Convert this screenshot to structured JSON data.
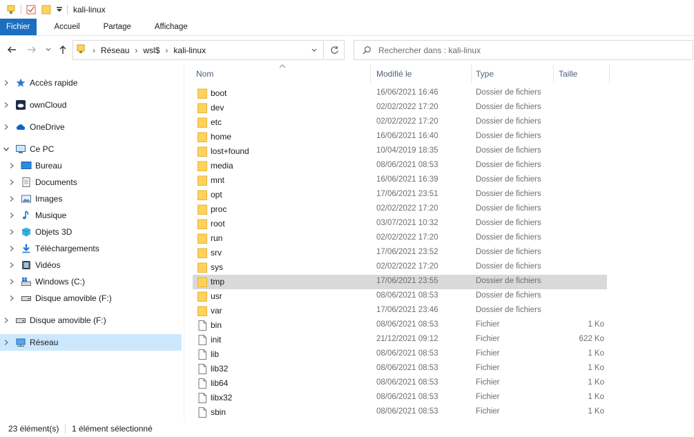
{
  "window": {
    "title": "kali-linux"
  },
  "ribbon": {
    "tabs": [
      "Fichier",
      "Accueil",
      "Partage",
      "Affichage"
    ]
  },
  "address": {
    "crumbs": [
      "Réseau",
      "wsl$",
      "kali-linux"
    ],
    "search_placeholder": "Rechercher dans : kali-linux"
  },
  "sidebar": {
    "items": [
      {
        "label": "Accès rapide",
        "icon": "star-icon",
        "level": 0,
        "expanded": false
      },
      {
        "label": "ownCloud",
        "icon": "owncloud-icon",
        "level": 0,
        "expanded": false
      },
      {
        "label": "OneDrive",
        "icon": "onedrive-icon",
        "level": 0,
        "expanded": false
      },
      {
        "label": "Ce PC",
        "icon": "pc-icon",
        "level": 0,
        "expanded": true
      },
      {
        "label": "Bureau",
        "icon": "desktop-icon",
        "level": 1,
        "expanded": false
      },
      {
        "label": "Documents",
        "icon": "documents-icon",
        "level": 1,
        "expanded": false
      },
      {
        "label": "Images",
        "icon": "images-icon",
        "level": 1,
        "expanded": false
      },
      {
        "label": "Musique",
        "icon": "music-icon",
        "level": 1,
        "expanded": false
      },
      {
        "label": "Objets 3D",
        "icon": "objects3d-icon",
        "level": 1,
        "expanded": false
      },
      {
        "label": "Téléchargements",
        "icon": "download-icon",
        "level": 1,
        "expanded": false
      },
      {
        "label": "Vidéos",
        "icon": "video-icon",
        "level": 1,
        "expanded": false
      },
      {
        "label": "Windows (C:)",
        "icon": "windows-drive-icon",
        "level": 1,
        "expanded": false
      },
      {
        "label": "Disque amovible (F:)",
        "icon": "removable-drive-icon",
        "level": 1,
        "expanded": false
      },
      {
        "label": "Disque amovible (F:)",
        "icon": "removable-drive-icon",
        "level": 0,
        "expanded": false
      },
      {
        "label": "Réseau",
        "icon": "network-icon",
        "level": 0,
        "expanded": false,
        "selected": true
      }
    ]
  },
  "columns": {
    "name": "Nom",
    "modified": "Modifié le",
    "type": "Type",
    "size": "Taille"
  },
  "files": [
    {
      "name": "boot",
      "modified": "16/06/2021 16:46",
      "type": "Dossier de fichiers",
      "size": "",
      "kind": "folder"
    },
    {
      "name": "dev",
      "modified": "02/02/2022 17:20",
      "type": "Dossier de fichiers",
      "size": "",
      "kind": "folder"
    },
    {
      "name": "etc",
      "modified": "02/02/2022 17:20",
      "type": "Dossier de fichiers",
      "size": "",
      "kind": "folder"
    },
    {
      "name": "home",
      "modified": "16/06/2021 16:40",
      "type": "Dossier de fichiers",
      "size": "",
      "kind": "folder"
    },
    {
      "name": "lost+found",
      "modified": "10/04/2019 18:35",
      "type": "Dossier de fichiers",
      "size": "",
      "kind": "folder"
    },
    {
      "name": "media",
      "modified": "08/06/2021 08:53",
      "type": "Dossier de fichiers",
      "size": "",
      "kind": "folder"
    },
    {
      "name": "mnt",
      "modified": "16/06/2021 16:39",
      "type": "Dossier de fichiers",
      "size": "",
      "kind": "folder"
    },
    {
      "name": "opt",
      "modified": "17/06/2021 23:51",
      "type": "Dossier de fichiers",
      "size": "",
      "kind": "folder"
    },
    {
      "name": "proc",
      "modified": "02/02/2022 17:20",
      "type": "Dossier de fichiers",
      "size": "",
      "kind": "folder"
    },
    {
      "name": "root",
      "modified": "03/07/2021 10:32",
      "type": "Dossier de fichiers",
      "size": "",
      "kind": "folder"
    },
    {
      "name": "run",
      "modified": "02/02/2022 17:20",
      "type": "Dossier de fichiers",
      "size": "",
      "kind": "folder"
    },
    {
      "name": "srv",
      "modified": "17/06/2021 23:52",
      "type": "Dossier de fichiers",
      "size": "",
      "kind": "folder"
    },
    {
      "name": "sys",
      "modified": "02/02/2022 17:20",
      "type": "Dossier de fichiers",
      "size": "",
      "kind": "folder"
    },
    {
      "name": "tmp",
      "modified": "17/06/2021 23:55",
      "type": "Dossier de fichiers",
      "size": "",
      "kind": "folder",
      "selected": true
    },
    {
      "name": "usr",
      "modified": "08/06/2021 08:53",
      "type": "Dossier de fichiers",
      "size": "",
      "kind": "folder"
    },
    {
      "name": "var",
      "modified": "17/06/2021 23:46",
      "type": "Dossier de fichiers",
      "size": "",
      "kind": "folder"
    },
    {
      "name": "bin",
      "modified": "08/06/2021 08:53",
      "type": "Fichier",
      "size": "1 Ko",
      "kind": "file"
    },
    {
      "name": "init",
      "modified": "21/12/2021 09:12",
      "type": "Fichier",
      "size": "622 Ko",
      "kind": "file"
    },
    {
      "name": "lib",
      "modified": "08/06/2021 08:53",
      "type": "Fichier",
      "size": "1 Ko",
      "kind": "file"
    },
    {
      "name": "lib32",
      "modified": "08/06/2021 08:53",
      "type": "Fichier",
      "size": "1 Ko",
      "kind": "file"
    },
    {
      "name": "lib64",
      "modified": "08/06/2021 08:53",
      "type": "Fichier",
      "size": "1 Ko",
      "kind": "file"
    },
    {
      "name": "libx32",
      "modified": "08/06/2021 08:53",
      "type": "Fichier",
      "size": "1 Ko",
      "kind": "file"
    },
    {
      "name": "sbin",
      "modified": "08/06/2021 08:53",
      "type": "Fichier",
      "size": "1 Ko",
      "kind": "file"
    }
  ],
  "status": {
    "count": "23 élément(s)",
    "selection": "1 élément sélectionné"
  },
  "colors": {
    "accent": "#1a6fc1",
    "selection": "#d9d9d9",
    "nav_selection": "#cce8ff",
    "folder": "#ffd25c"
  }
}
